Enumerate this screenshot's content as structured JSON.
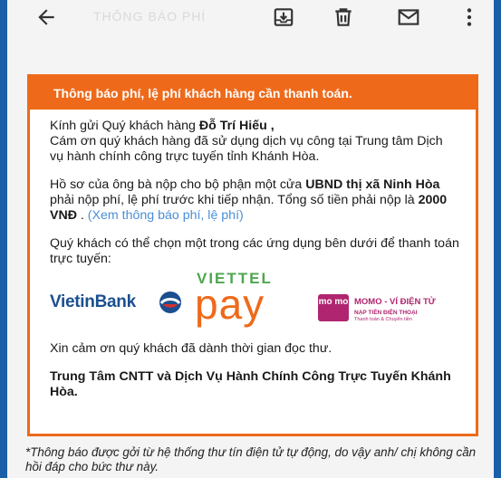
{
  "appbar": {
    "faded_title": "THÔNG BÁO PHÍ",
    "icons": [
      "back-arrow-icon",
      "save-icon",
      "trash-icon",
      "mail-icon",
      "more-vert-icon"
    ]
  },
  "email": {
    "banner": "Thông báo phí, lệ phí khách hàng cần thanh toán.",
    "greeting_prefix": "Kính gửi Quý khách hàng ",
    "customer_name": "Đỗ Trí Hiếu",
    "greeting_suffix": " ,",
    "thanks_line": "Cám ơn quý khách hàng đã sử dụng dịch vụ công tại Trung tâm Dịch vụ hành chính công trực tuyến tỉnh Khánh Hòa.",
    "dossier_prefix": "Hồ sơ của ông bà nộp cho bộ phận một cửa ",
    "office": "UBND thị xã Ninh Hòa",
    "dossier_mid": " phải nộp phí, lệ phí trước khi tiếp nhận. Tổng số tiền phải nộp là ",
    "amount": "2000 VNĐ",
    "dossier_end": " . ",
    "view_fee_link": "(Xem thông báo phí, lệ phí)",
    "choose_app": "Quý khách có thể chọn một trong các ứng dụng bên dưới để thanh toán trực tuyến:",
    "logos": {
      "vietinbank": "VietinBank",
      "viettel": "VIETTEL",
      "pay": "pay",
      "momo_mark": "mo mo",
      "momo_title": "MOMO - VÍ ĐIỆN TỬ",
      "momo_sub": "NẠP TIỀN ĐIỆN THOẠI",
      "momo_sub2": "Thanh toán & Chuyển tiền"
    },
    "closing": "Xin cảm ơn quý khách đã dành thời gian đọc thư.",
    "signature": "Trung Tâm CNTT và Dịch Vụ Hành Chính Công Trực Tuyến Khánh Hòa."
  },
  "footer_note": "*Thông báo được gởi từ hệ thống thư tín điện tử tự động, do vậy anh/ chị không cần hồi đáp cho bức thư này.",
  "colors": {
    "accent": "#ee6a1a",
    "link": "#4a8fd6",
    "background": "#1b5fa8"
  }
}
